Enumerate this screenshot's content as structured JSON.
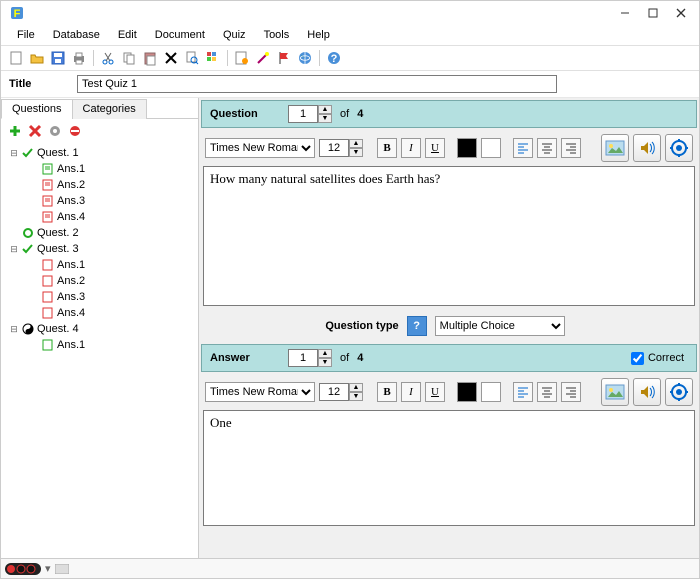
{
  "app": {
    "title": ""
  },
  "menu": {
    "file": "File",
    "database": "Database",
    "edit": "Edit",
    "document": "Document",
    "quiz": "Quiz",
    "tools": "Tools",
    "help": "Help"
  },
  "title_field": {
    "label": "Title",
    "value": "Test Quiz 1"
  },
  "tabs": {
    "questions": "Questions",
    "categories": "Categories"
  },
  "tree": {
    "q1": "Quest. 1",
    "q2": "Quest. 2",
    "q3": "Quest. 3",
    "q4": "Quest. 4",
    "a1": "Ans.1",
    "a2": "Ans.2",
    "a3": "Ans.3",
    "a4": "Ans.4"
  },
  "question": {
    "header": "Question",
    "number": "1",
    "of": "of",
    "total": "4",
    "font": "Times New Roman",
    "size": "12",
    "text": "How many natural satellites does Earth has?"
  },
  "qtype": {
    "label": "Question type",
    "value": "Multiple Choice"
  },
  "answer": {
    "header": "Answer",
    "number": "1",
    "of": "of",
    "total": "4",
    "correct_label": "Correct",
    "correct": true,
    "font": "Times New Roman",
    "size": "12",
    "text": "One"
  },
  "colors": {
    "header_bg": "#b4e0e0"
  }
}
